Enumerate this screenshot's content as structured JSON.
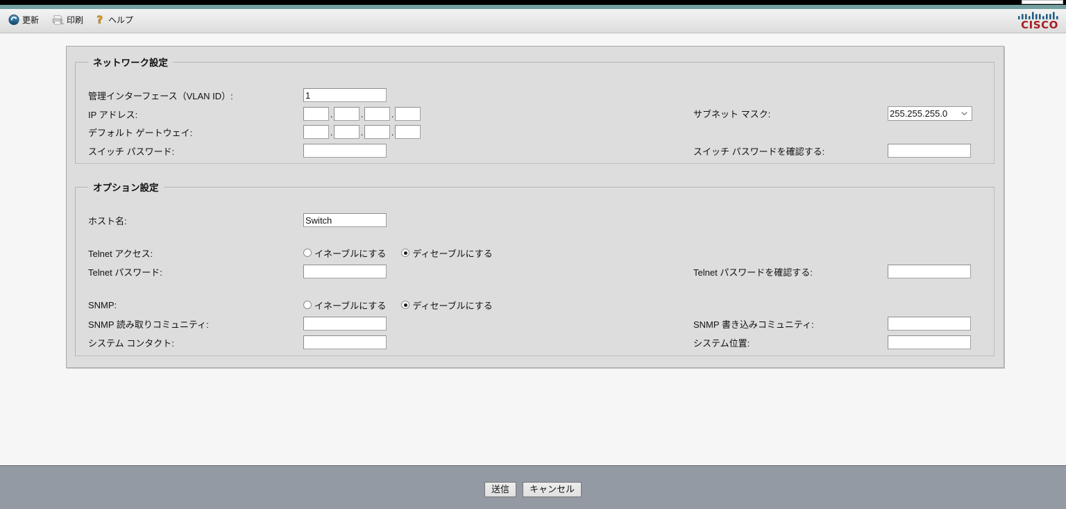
{
  "toolbar": {
    "items": [
      {
        "icon": "refresh-icon",
        "label": "更新"
      },
      {
        "icon": "print-icon",
        "label": "印刷"
      },
      {
        "icon": "help-icon",
        "label": "ヘルプ"
      }
    ],
    "brand": "CISCO"
  },
  "network": {
    "legend": "ネットワーク設定",
    "vlan_label": "管理インターフェース（VLAN ID）:",
    "vlan_value": "1",
    "ip_label": "IP アドレス:",
    "ip_octets": [
      "",
      "",
      "",
      ""
    ],
    "ip_separator": ".",
    "gateway_label": "デフォルト ゲートウェイ:",
    "gateway_octets": [
      "",
      "",
      "",
      ""
    ],
    "switch_password_label": "スイッチ パスワード:",
    "switch_password_value": "",
    "subnet_label": "サブネット マスク:",
    "subnet_value": "255.255.255.0",
    "subnet_options": [
      "255.255.255.0"
    ],
    "switch_password_confirm_label": "スイッチ パスワードを確認する:",
    "switch_password_confirm_value": ""
  },
  "options": {
    "legend": "オプション設定",
    "hostname_label": "ホスト名:",
    "hostname_value": "Switch",
    "telnet_access_label": "Telnet アクセス:",
    "telnet_enable_label": "イネーブルにする",
    "telnet_disable_label": "ディセーブルにする",
    "telnet_selected": "disable",
    "telnet_password_label": "Telnet パスワード:",
    "telnet_password_value": "",
    "telnet_password_confirm_label": "Telnet パスワードを確認する:",
    "telnet_password_confirm_value": "",
    "snmp_label": "SNMP:",
    "snmp_enable_label": "イネーブルにする",
    "snmp_disable_label": "ディセーブルにする",
    "snmp_selected": "disable",
    "snmp_read_label": "SNMP 読み取りコミュニティ:",
    "snmp_read_value": "",
    "snmp_write_label": "SNMP 書き込みコミュニティ:",
    "snmp_write_value": "",
    "sys_contact_label": "システム コンタクト:",
    "sys_contact_value": "",
    "sys_location_label": "システム位置:",
    "sys_location_value": ""
  },
  "footer": {
    "submit_label": "送信",
    "cancel_label": "キャンセル"
  },
  "colors": {
    "brand_red": "#a51f23",
    "brand_blue": "#1f5d84",
    "teal_band": "#74a0a0",
    "footer_bar": "#949aa3",
    "panel_bg": "#dddddd"
  }
}
